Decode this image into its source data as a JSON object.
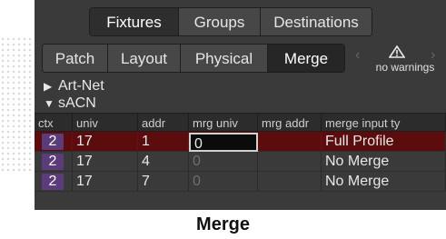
{
  "top_tabs": [
    {
      "label": "Fixtures",
      "selected": true
    },
    {
      "label": "Groups",
      "selected": false
    },
    {
      "label": "Destinations",
      "selected": false
    }
  ],
  "sub_tabs": [
    {
      "label": "Patch",
      "selected": false
    },
    {
      "label": "Layout",
      "selected": false
    },
    {
      "label": "Physical",
      "selected": false
    },
    {
      "label": "Merge",
      "selected": true
    }
  ],
  "warnings": {
    "icon": "warning-triangle-icon",
    "text": "no warnings",
    "prev": "‹",
    "next": "›"
  },
  "tree": {
    "artnet": {
      "label": "Art-Net",
      "expanded": false,
      "arrow": "▶"
    },
    "sacn": {
      "label": "sACN",
      "expanded": true,
      "arrow": "▼"
    }
  },
  "table": {
    "columns": [
      "ctx",
      "univ",
      "addr",
      "mrg univ",
      "mrg addr",
      "merge input ty"
    ],
    "rows": [
      {
        "ctx": "2",
        "univ": "17",
        "addr": "1",
        "mrg_univ": "0",
        "mrg_addr": "",
        "merge_input": "Full Profile",
        "selected": true
      },
      {
        "ctx": "2",
        "univ": "17",
        "addr": "4",
        "mrg_univ": "0",
        "mrg_addr": "",
        "merge_input": "No Merge",
        "selected": false
      },
      {
        "ctx": "2",
        "univ": "17",
        "addr": "7",
        "mrg_univ": "0",
        "mrg_addr": "",
        "merge_input": "No Merge",
        "selected": false
      }
    ]
  },
  "caption": "Merge",
  "colors": {
    "selected_row": "#5c0c0c",
    "ctx_badge": "#5b3b7a",
    "panel_bg": "#3a3a3a"
  }
}
